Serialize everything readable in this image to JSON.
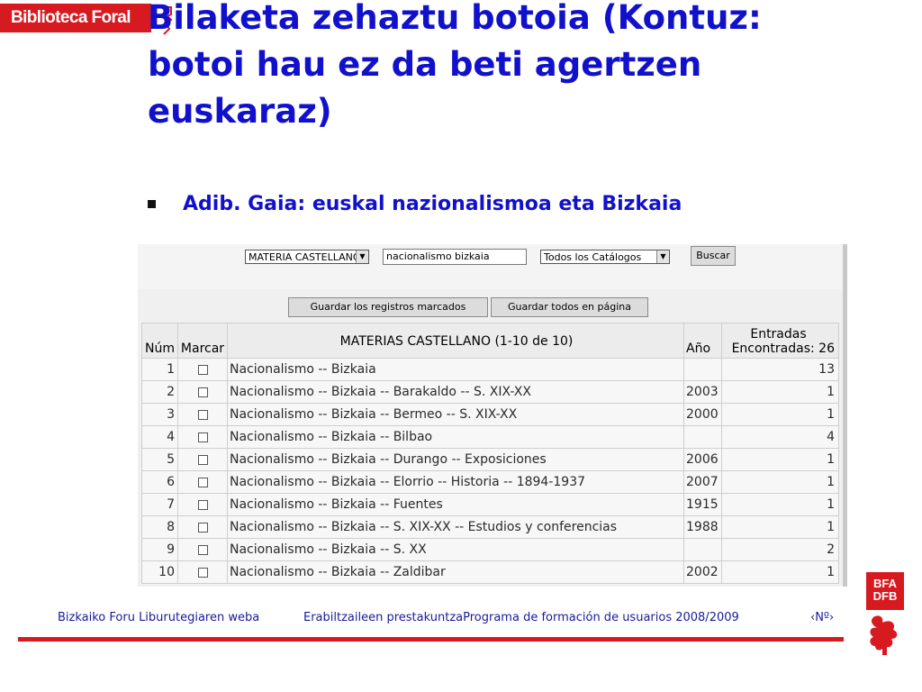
{
  "header": {
    "logo_text": "Biblioteca Foral"
  },
  "slide": {
    "title": "Bilaketa zehaztu botoia (Kontuz: botoi hau ez da beti agertzen euskaraz)",
    "bullet": "Adib. Gaia: euskal nazionalismoa eta Bizkaia"
  },
  "search": {
    "field_select": "MATERIA CASTELLANO",
    "query": "nacionalismo bizkaia",
    "catalog_select": "Todos los Catálogos",
    "search_label": "Buscar"
  },
  "actions": {
    "save_marked": "Guardar los registros marcados",
    "save_page": "Guardar todos en página"
  },
  "table": {
    "headers": {
      "num": "Núm",
      "mark": "Marcar",
      "subject": "MATERIAS CASTELLANO (1-10 de 10)",
      "year": "Año",
      "entries_line1": "Entradas",
      "entries_line2": "Encontradas: 26"
    },
    "rows": [
      {
        "num": "1",
        "subject": "Nacionalismo -- Bizkaia",
        "year": "",
        "count": "13"
      },
      {
        "num": "2",
        "subject": "Nacionalismo -- Bizkaia -- Barakaldo -- S. XIX-XX",
        "year": "2003",
        "count": "1"
      },
      {
        "num": "3",
        "subject": "Nacionalismo -- Bizkaia -- Bermeo -- S. XIX-XX",
        "year": "2000",
        "count": "1"
      },
      {
        "num": "4",
        "subject": "Nacionalismo -- Bizkaia -- Bilbao",
        "year": "",
        "count": "4"
      },
      {
        "num": "5",
        "subject": "Nacionalismo -- Bizkaia -- Durango -- Exposiciones",
        "year": "2006",
        "count": "1"
      },
      {
        "num": "6",
        "subject": "Nacionalismo -- Bizkaia -- Elorrio -- Historia -- 1894-1937",
        "year": "2007",
        "count": "1"
      },
      {
        "num": "7",
        "subject": "Nacionalismo -- Bizkaia -- Fuentes",
        "year": "1915",
        "count": "1"
      },
      {
        "num": "8",
        "subject": "Nacionalismo -- Bizkaia -- S. XIX-XX -- Estudios y conferencias",
        "year": "1988",
        "count": "1"
      },
      {
        "num": "9",
        "subject": "Nacionalismo -- Bizkaia -- S. XX",
        "year": "",
        "count": "2"
      },
      {
        "num": "10",
        "subject": "Nacionalismo -- Bizkaia -- Zaldibar",
        "year": "2002",
        "count": "1"
      }
    ]
  },
  "footer": {
    "left": "Bizkaiko Foru Liburutegiaren weba",
    "middle": "Erabiltzaileen prestakuntzaPrograma de formación de usuarios 2008/2009",
    "right": "‹Nº›",
    "logo_line1": "BFA",
    "logo_line2": "DFB"
  },
  "colors": {
    "brand_red": "#d71920",
    "title_blue": "#1111cc",
    "footer_blue": "#1a1a99"
  }
}
